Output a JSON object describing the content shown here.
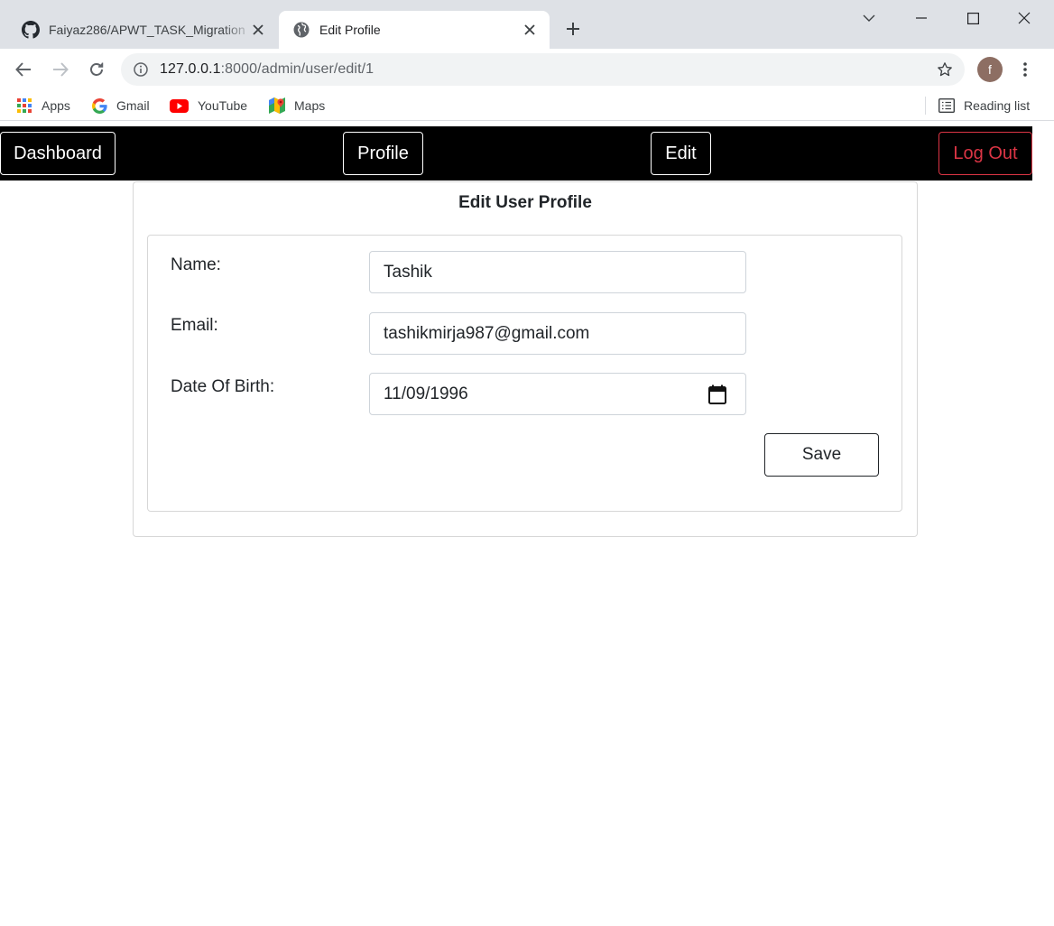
{
  "browser": {
    "tabs": [
      {
        "title": "Faiyaz286/APWT_TASK_Migration",
        "icon": "github-icon",
        "active": false
      },
      {
        "title": "Edit Profile",
        "icon": "globe-icon",
        "active": true
      }
    ],
    "url": {
      "host": "127.0.0.1",
      "rest": ":8000/admin/user/edit/1"
    },
    "profile_initial": "f",
    "bookmarks": [
      {
        "label": "Apps",
        "icon": "apps-grid-icon"
      },
      {
        "label": "Gmail",
        "icon": "google-icon"
      },
      {
        "label": "YouTube",
        "icon": "youtube-icon"
      },
      {
        "label": "Maps",
        "icon": "maps-icon"
      }
    ],
    "reading_list": "Reading list"
  },
  "nav": {
    "dashboard": "Dashboard",
    "profile": "Profile",
    "edit": "Edit",
    "logout": "Log Out"
  },
  "form": {
    "title": "Edit User Profile",
    "fields": [
      {
        "label": "Name:",
        "value": "Tashik"
      },
      {
        "label": "Email:",
        "value": "tashikmirja987@gmail.com"
      },
      {
        "label": "Date Of Birth:",
        "value": "11/09/1996"
      }
    ],
    "save_label": "Save"
  },
  "colors": {
    "navbar_bg": "#000000",
    "logout": "#dc3545",
    "tabstrip": "#dee1e6",
    "omnibox": "#f1f3f4"
  }
}
